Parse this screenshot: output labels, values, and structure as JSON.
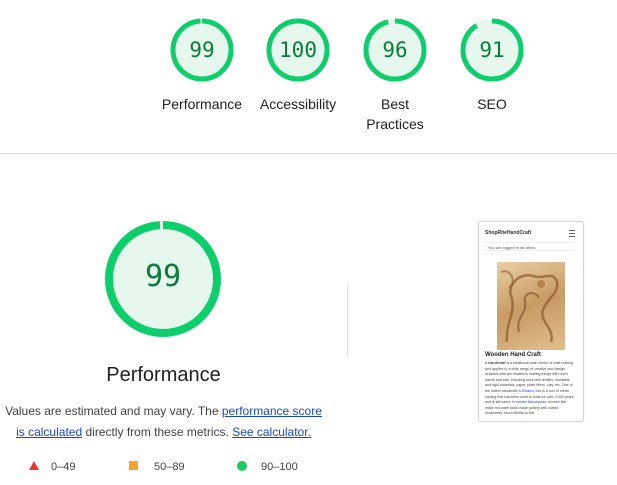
{
  "summary_gauges": [
    {
      "score": "99",
      "label": "Performance",
      "fraction": 0.99
    },
    {
      "score": "100",
      "label": "Accessibility",
      "fraction": 1.0
    },
    {
      "score": "96",
      "label": "Best Practices",
      "fraction": 0.96
    },
    {
      "score": "91",
      "label": "SEO",
      "fraction": 0.91
    }
  ],
  "performance": {
    "score": "99",
    "fraction": 0.99,
    "title": "Performance",
    "desc_text1": "Values are estimated and may vary. The ",
    "desc_link1": "performance score is calculated",
    "desc_text2": " directly from these metrics. ",
    "desc_link2": "See calculator."
  },
  "legend": [
    {
      "range": "0–49",
      "color": "#e53935",
      "shape": "triangle"
    },
    {
      "range": "50–89",
      "color": "#f6a623",
      "shape": "square"
    },
    {
      "range": "90–100",
      "color": "#18c964",
      "shape": "circle"
    }
  ],
  "thumbnail": {
    "site_name": "ShopRiteHandCraft",
    "login_text": "You are logged in as demo",
    "heading": "Wooden Hand Craft",
    "body_a": "A ",
    "body_b": "handicraft",
    "body_c": " is a traditional main sector of craft making and applies to a wide range of creative and design activities that are related to making things with one's hands and skill, including work with textiles, moldable and rigid materials, paper, plant fibers, clay, etc. One of the oldest handicraft is ",
    "body_link1": "Dhokra",
    "body_d": "; this is a sort of metal casting that has been used in India for over 4,000 years and is still used. In ",
    "body_link2": "Iranian Baluchistan",
    "body_e": ", women still make red ware hand-made pottery with dotted ornaments, much similar to the"
  },
  "colors": {
    "pass_ring": "#0cce6b",
    "pass_fill": "#e6f7ed",
    "pass_text": "#0a7d3c"
  }
}
